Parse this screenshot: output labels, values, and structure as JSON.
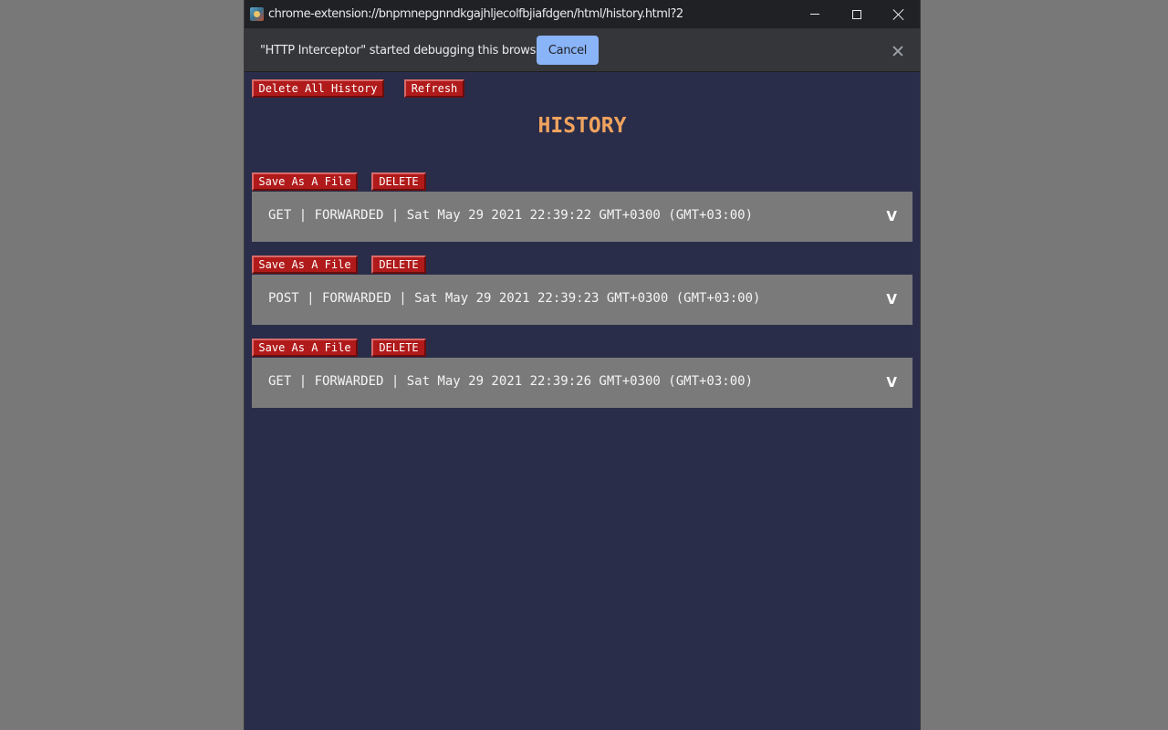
{
  "window": {
    "title": "chrome-extension://bnpmnepgnndkgajhljecolfbjiafdgen/html/history.html?2"
  },
  "infobar": {
    "message": "\"HTTP Interceptor\" started debugging this browser",
    "cancel_label": "Cancel"
  },
  "toolbar": {
    "delete_all_label": "Delete All History",
    "refresh_label": "Refresh"
  },
  "page_title": "HISTORY",
  "entries": [
    {
      "save_label": "Save As A File",
      "delete_label": "DELETE",
      "summary": "GET | FORWARDED | Sat May 29 2021 22:39:22 GMT+0300 (GMT+03:00)",
      "toggle": "V"
    },
    {
      "save_label": "Save As A File",
      "delete_label": "DELETE",
      "summary": "POST | FORWARDED | Sat May 29 2021 22:39:23 GMT+0300 (GMT+03:00)",
      "toggle": "V"
    },
    {
      "save_label": "Save As A File",
      "delete_label": "DELETE",
      "summary": "GET | FORWARDED | Sat May 29 2021 22:39:26 GMT+0300 (GMT+03:00)",
      "toggle": "V"
    }
  ],
  "colors": {
    "desktop": "#787878",
    "page_background": "#2a2d4a",
    "button_red": "#b01a1a",
    "heading_orange": "#f0a35e",
    "entry_background": "#7a7a7a",
    "infobar_button": "#8ab4f8"
  },
  "icons": {
    "app": "extension-app-icon",
    "minimize": "minimize-icon",
    "maximize": "maximize-icon",
    "close": "close-icon",
    "dismiss": "close-icon"
  }
}
